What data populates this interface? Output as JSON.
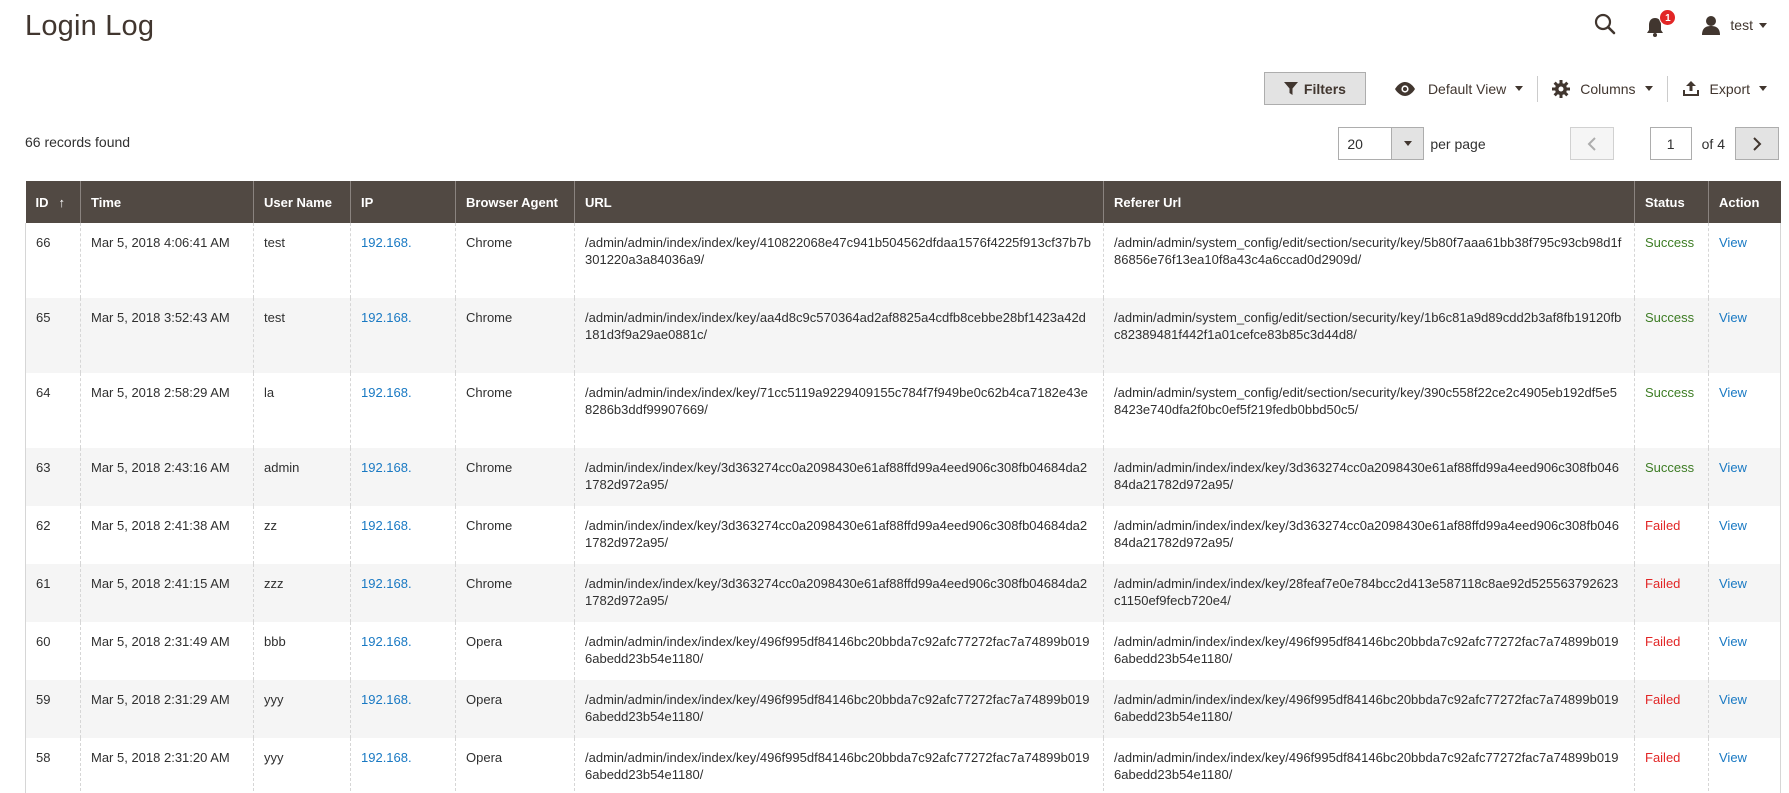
{
  "page": {
    "title": "Login Log"
  },
  "header": {
    "notification_count": "1",
    "user_name": "test"
  },
  "toolbar": {
    "filters_label": "Filters",
    "default_view_label": "Default View",
    "columns_label": "Columns",
    "export_label": "Export"
  },
  "records_found": "66 records found",
  "pagination": {
    "per_page_value": "20",
    "per_page_label": "per page",
    "current_page": "1",
    "total_label": "of 4"
  },
  "table": {
    "columns": [
      "ID",
      "Time",
      "User Name",
      "IP",
      "Browser Agent",
      "URL",
      "Referer Url",
      "Status",
      "Action"
    ],
    "sort_indicator": "↑",
    "rows": [
      {
        "id": "66",
        "time": "Mar 5, 2018 4:06:41 AM",
        "user": "test",
        "ip": "192.168.",
        "browser": "Chrome",
        "url": "/admin/admin/index/index/key/410822068e47c941b504562dfdaa1576f4225f913cf37b7b301220a3a84036a9/",
        "referer": "/admin/admin/system_config/edit/section/security/key/5b80f7aaa61bb38f795c93cb98d1f86856e76f13ea10f8a43c4a6ccad0d2909d/",
        "status": "Success",
        "action": "View"
      },
      {
        "id": "65",
        "time": "Mar 5, 2018 3:52:43 AM",
        "user": "test",
        "ip": "192.168.",
        "browser": "Chrome",
        "url": "/admin/admin/index/index/key/aa4d8c9c570364ad2af8825a4cdfb8cebbe28bf1423a42d181d3f9a29ae0881c/",
        "referer": "/admin/admin/system_config/edit/section/security/key/1b6c81a9d89cdd2b3af8fb19120fbc82389481f442f1a01cefce83b85c3d44d8/",
        "status": "Success",
        "action": "View"
      },
      {
        "id": "64",
        "time": "Mar 5, 2018 2:58:29 AM",
        "user": "la",
        "ip": "192.168.",
        "browser": "Chrome",
        "url": "/admin/admin/index/index/key/71cc5119a9229409155c784f7f949be0c62b4ca7182e43e8286b3ddf99907669/",
        "referer": "/admin/admin/system_config/edit/section/security/key/390c558f22ce2c4905eb192df5e58423e740dfa2f0bc0ef5f219fedb0bbd50c5/",
        "status": "Success",
        "action": "View"
      },
      {
        "id": "63",
        "time": "Mar 5, 2018 2:43:16 AM",
        "user": "admin",
        "ip": "192.168.",
        "browser": "Chrome",
        "url": "/admin/index/index/key/3d363274cc0a2098430e61af88ffd99a4eed906c308fb04684da21782d972a95/",
        "referer": "/admin/admin/index/index/key/3d363274cc0a2098430e61af88ffd99a4eed906c308fb04684da21782d972a95/",
        "status": "Success",
        "action": "View"
      },
      {
        "id": "62",
        "time": "Mar 5, 2018 2:41:38 AM",
        "user": "zz",
        "ip": "192.168.",
        "browser": "Chrome",
        "url": "/admin/index/index/key/3d363274cc0a2098430e61af88ffd99a4eed906c308fb04684da21782d972a95/",
        "referer": "/admin/admin/index/index/key/3d363274cc0a2098430e61af88ffd99a4eed906c308fb04684da21782d972a95/",
        "status": "Failed",
        "action": "View"
      },
      {
        "id": "61",
        "time": "Mar 5, 2018 2:41:15 AM",
        "user": "zzz",
        "ip": "192.168.",
        "browser": "Chrome",
        "url": "/admin/index/index/key/3d363274cc0a2098430e61af88ffd99a4eed906c308fb04684da21782d972a95/",
        "referer": "/admin/admin/index/index/key/28feaf7e0e784bcc2d413e587118c8ae92d525563792623c1150ef9fecb720e4/",
        "status": "Failed",
        "action": "View"
      },
      {
        "id": "60",
        "time": "Mar 5, 2018 2:31:49 AM",
        "user": "bbb",
        "ip": "192.168.",
        "browser": "Opera",
        "url": "/admin/admin/index/index/key/496f995df84146bc20bbda7c92afc77272fac7a74899b0196abedd23b54e1180/",
        "referer": "/admin/admin/index/index/key/496f995df84146bc20bbda7c92afc77272fac7a74899b0196abedd23b54e1180/",
        "status": "Failed",
        "action": "View"
      },
      {
        "id": "59",
        "time": "Mar 5, 2018 2:31:29 AM",
        "user": "yyy",
        "ip": "192.168.",
        "browser": "Opera",
        "url": "/admin/admin/index/index/key/496f995df84146bc20bbda7c92afc77272fac7a74899b0196abedd23b54e1180/",
        "referer": "/admin/admin/index/index/key/496f995df84146bc20bbda7c92afc77272fac7a74899b0196abedd23b54e1180/",
        "status": "Failed",
        "action": "View"
      },
      {
        "id": "58",
        "time": "Mar 5, 2018 2:31:20 AM",
        "user": "yyy",
        "ip": "192.168.",
        "browser": "Opera",
        "url": "/admin/admin/index/index/key/496f995df84146bc20bbda7c92afc77272fac7a74899b0196abedd23b54e1180/",
        "referer": "/admin/admin/index/index/key/496f995df84146bc20bbda7c92afc77272fac7a74899b0196abedd23b54e1180/",
        "status": "Failed",
        "action": "View"
      }
    ]
  },
  "colors": {
    "header_bg": "#514943",
    "link": "#1979c3",
    "success": "#3d7c24",
    "failed": "#e22626"
  },
  "icons": [
    "search-icon",
    "bell-icon",
    "user-icon",
    "filter-icon",
    "eye-icon",
    "gear-icon",
    "export-icon",
    "chevron-left-icon",
    "chevron-right-icon"
  ]
}
